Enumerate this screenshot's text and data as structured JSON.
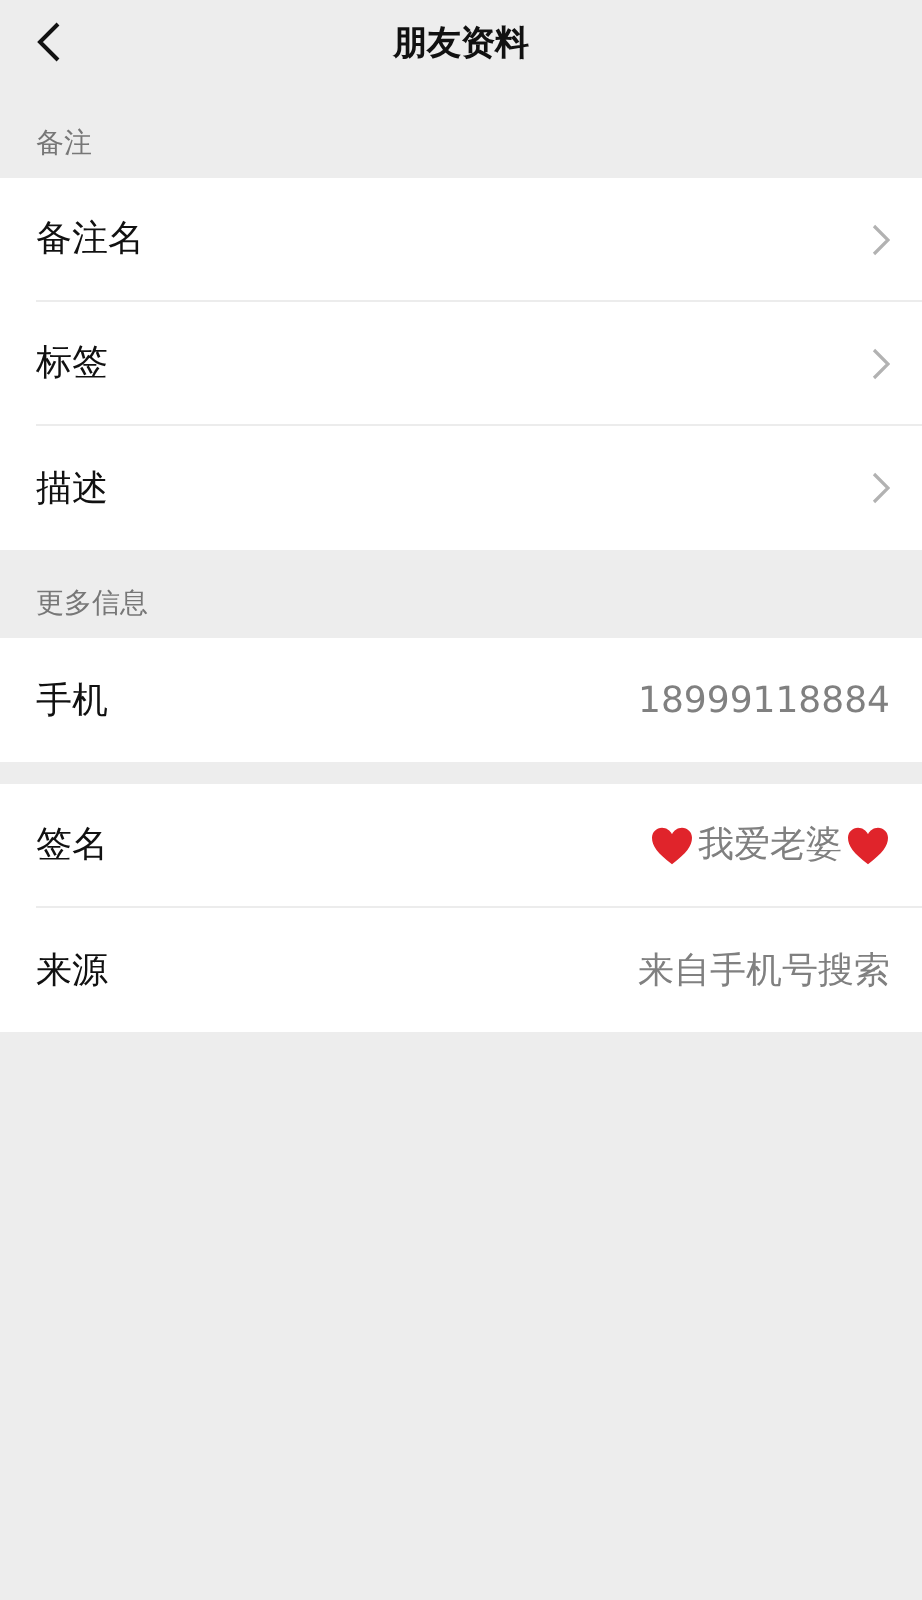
{
  "header": {
    "title": "朋友资料"
  },
  "groups": [
    {
      "label": "备注",
      "rows": [
        {
          "kind": "link",
          "label": "备注名"
        },
        {
          "kind": "link",
          "label": "标签"
        },
        {
          "kind": "link",
          "label": "描述"
        }
      ]
    },
    {
      "label": "更多信息",
      "rows": [
        {
          "kind": "value",
          "label": "手机",
          "value": "18999118884"
        }
      ]
    },
    {
      "rows": [
        {
          "kind": "hearts",
          "label": "签名",
          "value": "我爱老婆"
        },
        {
          "kind": "value",
          "label": "来源",
          "value": "来自手机号搜索"
        }
      ]
    }
  ]
}
